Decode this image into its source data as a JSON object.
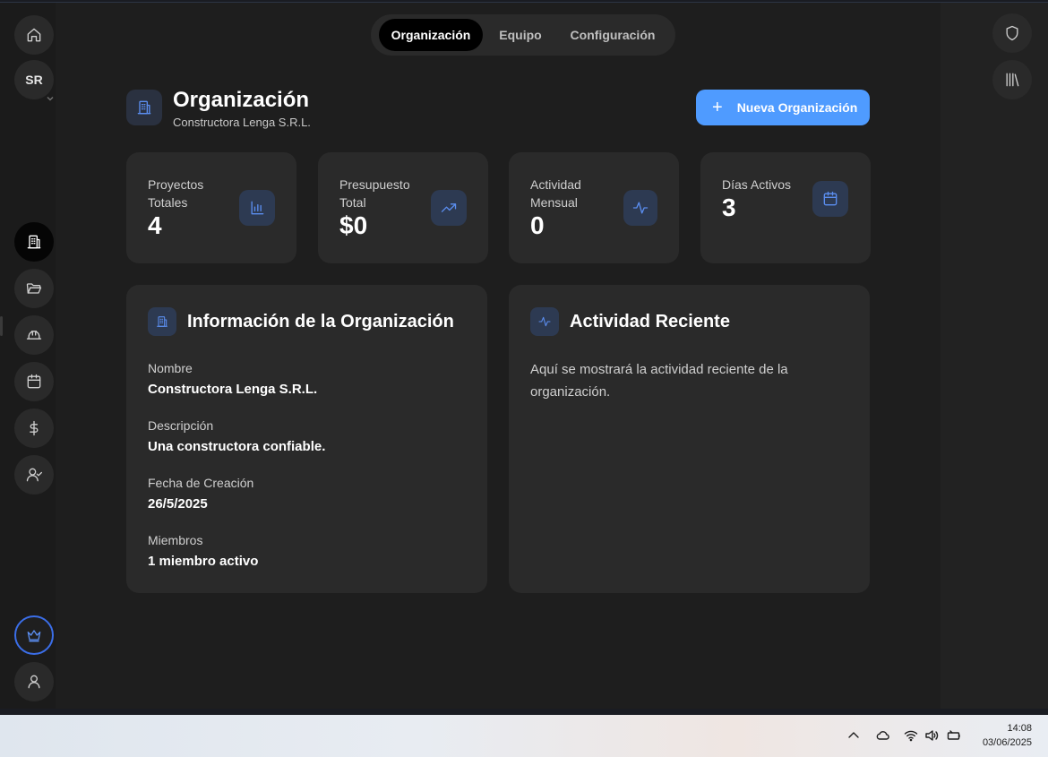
{
  "sidebar": {
    "avatar_initials": "SR",
    "items": [
      {
        "name": "home",
        "icon": "home-icon"
      },
      {
        "name": "organization",
        "icon": "building-icon",
        "active": true
      },
      {
        "name": "projects",
        "icon": "folder-open-icon"
      },
      {
        "name": "construction",
        "icon": "hard-hat-icon"
      },
      {
        "name": "calendar",
        "icon": "calendar-icon"
      },
      {
        "name": "finance",
        "icon": "dollar-icon"
      },
      {
        "name": "contacts",
        "icon": "user-check-icon"
      },
      {
        "name": "plan",
        "icon": "crown-icon"
      },
      {
        "name": "profile",
        "icon": "user-icon"
      }
    ]
  },
  "tabs": {
    "items": [
      {
        "label": "Organización",
        "active": true
      },
      {
        "label": "Equipo",
        "active": false
      },
      {
        "label": "Configuración",
        "active": false
      }
    ]
  },
  "header": {
    "title": "Organización",
    "subtitle": "Constructora Lenga S.R.L.",
    "new_button_label": "Nueva Organización",
    "new_button_icon": "plus-icon"
  },
  "stats": [
    {
      "label": "Proyectos Totales",
      "value": "4",
      "icon": "bar-chart-icon"
    },
    {
      "label": "Presupuesto Total",
      "value": "$0",
      "icon": "trending-up-icon"
    },
    {
      "label": "Actividad Mensual",
      "value": "0",
      "icon": "activity-icon"
    },
    {
      "label": "Días Activos",
      "value": "3",
      "icon": "calendar-icon"
    }
  ],
  "info_panel": {
    "title": "Información de la Organización",
    "fields": [
      {
        "label": "Nombre",
        "value": "Constructora Lenga S.R.L."
      },
      {
        "label": "Descripción",
        "value": "Una constructora confiable."
      },
      {
        "label": "Fecha de Creación",
        "value": "26/5/2025"
      },
      {
        "label": "Miembros",
        "value": "1 miembro activo"
      }
    ]
  },
  "activity_panel": {
    "title": "Actividad Reciente",
    "message": "Aquí se mostrará la actividad reciente de la organización."
  },
  "right_rail": {
    "items": [
      {
        "name": "security",
        "icon": "shield-icon"
      },
      {
        "name": "library",
        "icon": "library-icon"
      }
    ]
  },
  "taskbar": {
    "time": "14:08",
    "date": "03/06/2025",
    "tray_icons": [
      "chevron-up-icon",
      "cloud-icon",
      "wifi-icon",
      "speaker-icon",
      "battery-icon"
    ]
  },
  "colors": {
    "accent": "#4f9bff",
    "icon_blue": "#5b8ef0",
    "card_bg": "#2a2a2a",
    "background": "#1e1e1e"
  }
}
